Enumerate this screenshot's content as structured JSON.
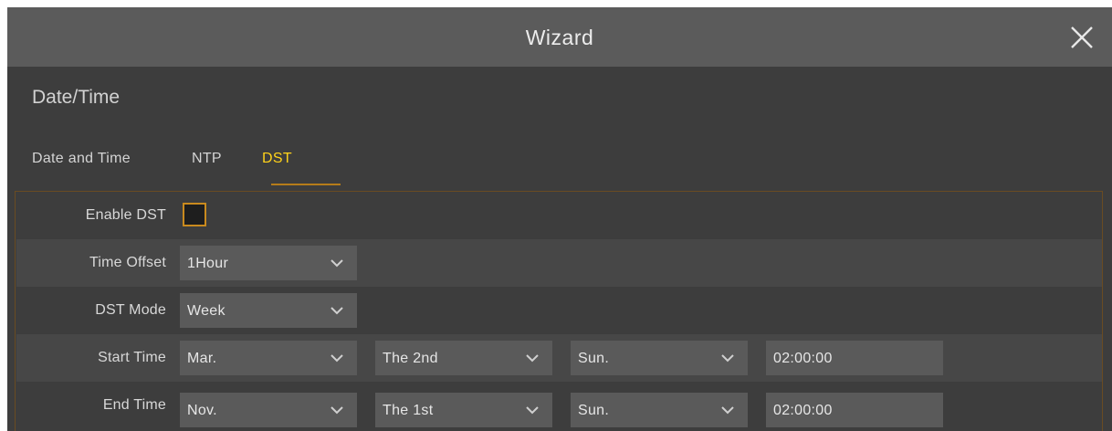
{
  "window": {
    "title": "Wizard",
    "close_icon": "close-icon"
  },
  "section": {
    "title": "Date/Time"
  },
  "tabs": [
    {
      "label": "Date and Time",
      "active": false
    },
    {
      "label": "NTP",
      "active": false
    },
    {
      "label": "DST",
      "active": true
    }
  ],
  "form": {
    "enable_dst": {
      "label": "Enable DST",
      "checked": false
    },
    "time_offset": {
      "label": "Time Offset",
      "value": "1Hour"
    },
    "dst_mode": {
      "label": "DST Mode",
      "value": "Week"
    },
    "start_time": {
      "label": "Start Time",
      "month": "Mar.",
      "week": "The 2nd",
      "day": "Sun.",
      "time": "02:00:00"
    },
    "end_time": {
      "label": "End Time",
      "month": "Nov.",
      "week": "The 1st",
      "day": "Sun.",
      "time": "02:00:00"
    }
  },
  "colors": {
    "accent": "#ffd21a",
    "accent_border": "#c98a1e",
    "titlebar": "#5b5b5b",
    "background": "#3d3d3d",
    "field": "#5a5a5a"
  }
}
